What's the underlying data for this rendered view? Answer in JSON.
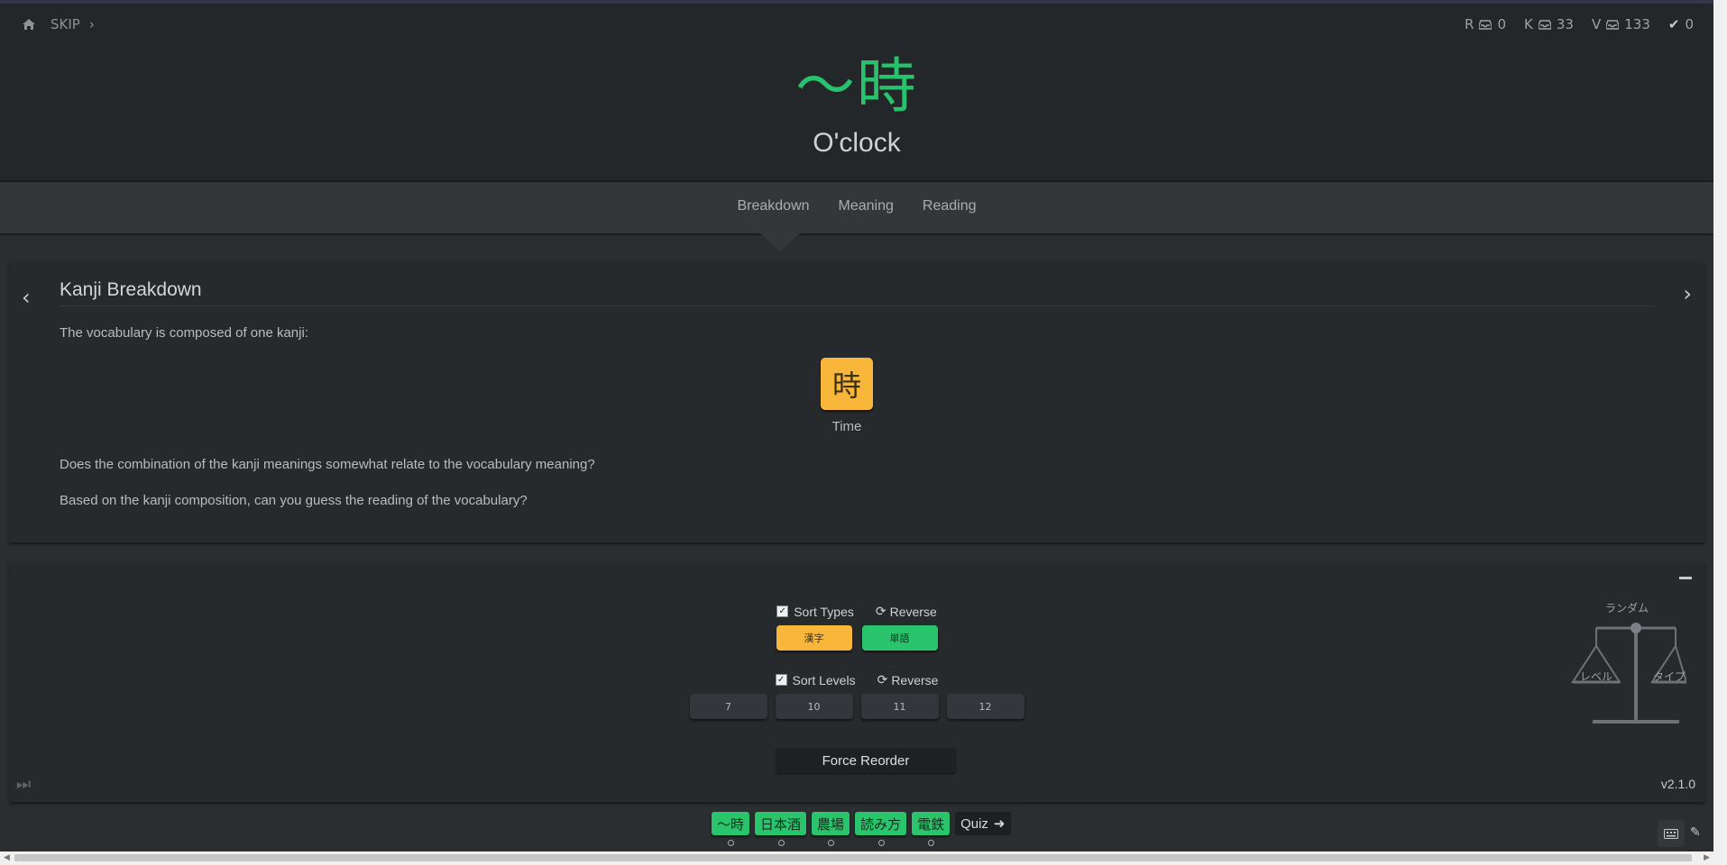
{
  "nav": {
    "skip_label": "SKIP"
  },
  "stats": [
    {
      "letter": "R",
      "count": "0"
    },
    {
      "letter": "K",
      "count": "33"
    },
    {
      "letter": "V",
      "count": "133"
    }
  ],
  "done_count": "0",
  "item": {
    "characters": "〜時",
    "meaning": "O'clock"
  },
  "tabs": [
    "Breakdown",
    "Meaning",
    "Reading"
  ],
  "breakdown": {
    "title": "Kanji Breakdown",
    "intro": "The vocabulary is composed of one kanji:",
    "kanji": {
      "character": "時",
      "meaning": "Time"
    },
    "q1": "Does the combination of the kanji meanings somewhat relate to the vocabulary meaning?",
    "q2": "Based on the kanji composition, can you guess the reading of the vocabulary?"
  },
  "reorder": {
    "sort_types_label": "Sort Types",
    "sort_levels_label": "Sort Levels",
    "reverse_label": "Reverse",
    "type_buttons": [
      "漢字",
      "単語"
    ],
    "level_buttons": [
      "7",
      "10",
      "11",
      "12"
    ],
    "force_label": "Force Reorder",
    "scale_top": "ランダム",
    "scale_left": "レベル",
    "scale_right": "タイプ",
    "version": "v2.1.0"
  },
  "queue": [
    "〜時",
    "日本酒",
    "農場",
    "読み方",
    "電鉄"
  ],
  "quiz_label": "Quiz",
  "colors": {
    "vocab": "#2ac46d",
    "kanji": "#f8b63b",
    "background": "#2b2e31"
  }
}
